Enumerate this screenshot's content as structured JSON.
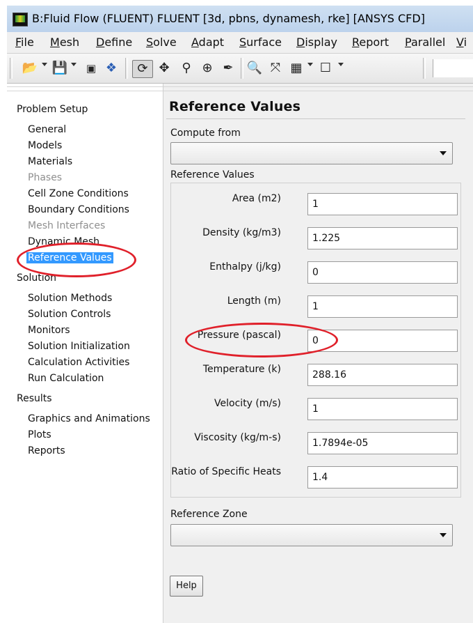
{
  "window": {
    "title": "B:Fluid Flow (FLUENT) FLUENT  [3d, pbns, dynamesh, rke] [ANSYS CFD]"
  },
  "menu": [
    "File",
    "Mesh",
    "Define",
    "Solve",
    "Adapt",
    "Surface",
    "Display",
    "Report",
    "Parallel",
    "Vi"
  ],
  "toolbar": {
    "icons": [
      "open-folder-icon",
      "save-icon",
      "snapshot-icon",
      "help-icon",
      "rotate-icon",
      "pan-icon",
      "zoom-icon",
      "zoom-box-icon",
      "probe-icon",
      "zoom-fit-icon",
      "axes-icon",
      "layout-icon",
      "window-icon"
    ]
  },
  "tree": {
    "problem_setup": "Problem Setup",
    "general": "General",
    "models": "Models",
    "materials": "Materials",
    "phases": "Phases",
    "cell_zone_conditions": "Cell Zone Conditions",
    "boundary_conditions": "Boundary Conditions",
    "mesh_interfaces": "Mesh Interfaces",
    "dynamic_mesh": "Dynamic Mesh",
    "reference_values": "Reference Values",
    "solution": "Solution",
    "solution_methods": "Solution Methods",
    "solution_controls": "Solution Controls",
    "monitors": "Monitors",
    "solution_initialization": "Solution Initialization",
    "calculation_activities": "Calculation Activities",
    "run_calculation": "Run Calculation",
    "results": "Results",
    "graphics_and_animations": "Graphics and Animations",
    "plots": "Plots",
    "reports": "Reports"
  },
  "panel": {
    "title": "Reference Values",
    "compute_from_label": "Compute from",
    "compute_from_value": "",
    "group_label": "Reference Values",
    "rows": [
      {
        "label": "Area (m2)",
        "value": "1"
      },
      {
        "label": "Density (kg/m3)",
        "value": "1.225"
      },
      {
        "label": "Enthalpy (j/kg)",
        "value": "0"
      },
      {
        "label": "Length (m)",
        "value": "1"
      },
      {
        "label": "Pressure (pascal)",
        "value": "0"
      },
      {
        "label": "Temperature (k)",
        "value": "288.16"
      },
      {
        "label": "Velocity (m/s)",
        "value": "1"
      },
      {
        "label": "Viscosity (kg/m-s)",
        "value": "1.7894e-05"
      },
      {
        "label": "Ratio of Specific Heats",
        "value": "1.4"
      }
    ],
    "reference_zone_label": "Reference Zone",
    "reference_zone_value": "",
    "help_label": "Help"
  },
  "colors": {
    "annotation": "#e0202a",
    "selection": "#3399ff"
  }
}
